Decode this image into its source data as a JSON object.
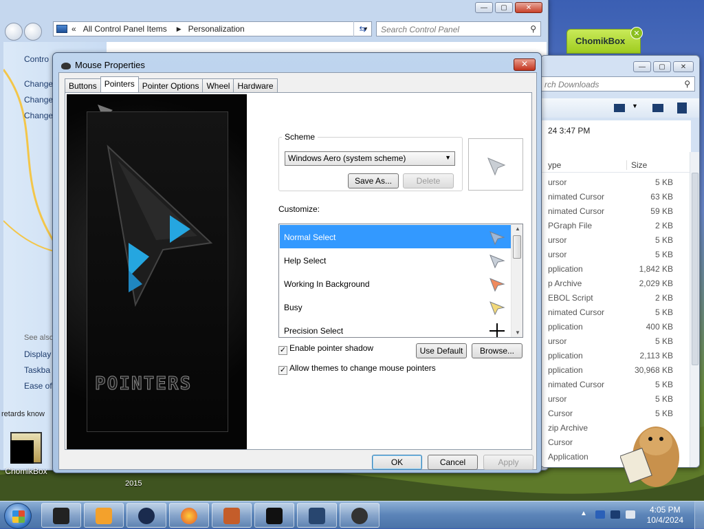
{
  "control_panel": {
    "breadcrumb": [
      "All Control Panel Items",
      "Personalization"
    ],
    "search_placeholder": "Search Control Panel",
    "sidebar_top": "Contro",
    "sidebar_items": [
      "Change",
      "Change",
      "Change"
    ],
    "see_also": "See also",
    "see_also_items": [
      "Display",
      "Taskba",
      "Ease of"
    ]
  },
  "downloads": {
    "search_placeholder": "rch Downloads",
    "date_text": "24 3:47 PM",
    "col_type": "ype",
    "col_size": "Size",
    "rows": [
      {
        "type": "ursor",
        "size": "5 KB"
      },
      {
        "type": "nimated Cursor",
        "size": "63 KB"
      },
      {
        "type": "nimated Cursor",
        "size": "59 KB"
      },
      {
        "type": "PGraph File",
        "size": "2 KB"
      },
      {
        "type": "ursor",
        "size": "5 KB"
      },
      {
        "type": "ursor",
        "size": "5 KB"
      },
      {
        "type": "pplication",
        "size": "1,842 KB"
      },
      {
        "type": "p Archive",
        "size": "2,029 KB"
      },
      {
        "type": "EBOL Script",
        "size": "2 KB"
      },
      {
        "type": "nimated Cursor",
        "size": "5 KB"
      },
      {
        "type": "pplication",
        "size": "400 KB"
      },
      {
        "type": "ursor",
        "size": "5 KB"
      },
      {
        "type": "pplication",
        "size": "2,113 KB"
      },
      {
        "type": "pplication",
        "size": "30,968 KB"
      },
      {
        "type": "nimated Cursor",
        "size": "5 KB"
      },
      {
        "type": "ursor",
        "size": "5 KB"
      },
      {
        "type": "Cursor",
        "size": "5 KB"
      },
      {
        "type": "zip Archive",
        "size": ""
      },
      {
        "type": "Cursor",
        "size": ""
      },
      {
        "type": "Application",
        "size": ""
      }
    ]
  },
  "chomikbox_tab": {
    "label": "ChomikBox",
    "close": "✕"
  },
  "dialog": {
    "title": "Mouse Properties",
    "close": "✕",
    "tabs": [
      "Buttons",
      "Pointers",
      "Pointer Options",
      "Wheel",
      "Hardware"
    ],
    "active_tab": "Pointers",
    "preview_logo": "POINTERS",
    "scheme_legend": "Scheme",
    "scheme_value": "Windows Aero (system scheme)",
    "save_as": "Save As...",
    "delete": "Delete",
    "customize_label": "Customize:",
    "cursors": [
      {
        "label": "Normal Select",
        "icon": "arrow-cursor-icon",
        "color": "#9fb7d6"
      },
      {
        "label": "Help Select",
        "icon": "help-cursor-icon",
        "color": "#c8cfd8"
      },
      {
        "label": "Working In Background",
        "icon": "working-cursor-icon",
        "color": "#f08a5d"
      },
      {
        "label": "Busy",
        "icon": "busy-cursor-icon",
        "color": "#f2d97a"
      },
      {
        "label": "Precision Select",
        "icon": "crosshair-cursor-icon",
        "color": "#000000"
      }
    ],
    "enable_shadow": "Enable pointer shadow",
    "allow_themes": "Allow themes to change mouse pointers",
    "use_default": "Use Default",
    "browse": "Browse...",
    "ok": "OK",
    "cancel": "Cancel",
    "apply": "Apply"
  },
  "desktop": {
    "icon_label": "ChomikBox",
    "year_label": "2015",
    "note_text": "retards know"
  },
  "taskbar": {
    "time": "4:05 PM",
    "date": "10/4/2024",
    "tray_arrow": "▲"
  }
}
